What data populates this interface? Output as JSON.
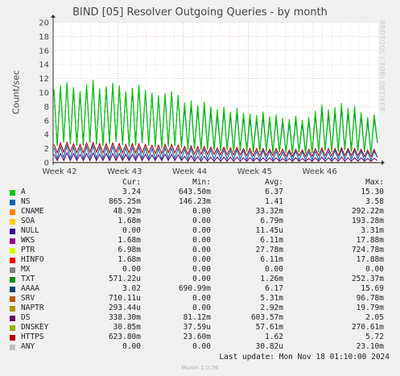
{
  "chart_data": {
    "type": "line",
    "title": "BIND [05] Resolver Outgoing Queries - by month",
    "ylabel": "Count/sec",
    "ylim": [
      0,
      20
    ],
    "yticks": [
      0,
      2,
      4,
      6,
      8,
      10,
      12,
      14,
      16,
      18,
      20
    ],
    "xticks": [
      "Week 42",
      "Week 43",
      "Week 44",
      "Week 45",
      "Week 46"
    ],
    "grid": true,
    "series": [
      {
        "name": "A",
        "color": "#00cc00",
        "cur": "3.24",
        "min": "643.50m",
        "avg": "6.37",
        "max": "15.30",
        "values": [
          10.5,
          2.5,
          11.0,
          3.0,
          11.5,
          2.8,
          10.8,
          2.5,
          10.2,
          2.6,
          11.2,
          3.0,
          11.8,
          2.7,
          10.6,
          2.5,
          10.9,
          2.8,
          11.4,
          3.1,
          11.0,
          2.6,
          10.2,
          2.4,
          10.7,
          2.6,
          11.1,
          2.9,
          10.4,
          2.5,
          10.0,
          2.3,
          9.6,
          2.2,
          9.9,
          2.4,
          10.2,
          2.5,
          9.7,
          2.3,
          8.6,
          2.0,
          8.9,
          2.1,
          8.2,
          1.9,
          8.7,
          2.0,
          8.0,
          1.9,
          7.6,
          1.8,
          8.0,
          1.9,
          7.3,
          1.7,
          7.8,
          1.8,
          7.1,
          1.7,
          7.0,
          1.6,
          6.8,
          1.6,
          7.3,
          1.7,
          6.6,
          1.5,
          6.9,
          1.6,
          6.4,
          1.5,
          6.2,
          1.4,
          6.7,
          1.6,
          6.1,
          1.4,
          6.5,
          1.5,
          7.4,
          1.6,
          8.3,
          1.8,
          7.6,
          1.6,
          7.9,
          1.7,
          8.5,
          1.9,
          7.8,
          1.7,
          8.1,
          1.7,
          7.2,
          1.6,
          6.5,
          1.4,
          6.9,
          3.0
        ]
      },
      {
        "name": "NS",
        "color": "#0066b3",
        "cur": "865.25m",
        "min": "146.23m",
        "avg": "1.41",
        "max": "3.58",
        "values": [
          2.1,
          0.6,
          2.3,
          0.7,
          2.4,
          0.6,
          2.2,
          0.6,
          2.1,
          0.6,
          2.3,
          0.7,
          2.4,
          0.6,
          2.2,
          0.6,
          2.2,
          0.6,
          2.3,
          0.7,
          2.2,
          0.6,
          2.1,
          0.6,
          2.2,
          0.6,
          2.2,
          0.6,
          2.1,
          0.6,
          2.0,
          0.5,
          2.0,
          0.5,
          2.1,
          0.6,
          2.1,
          0.6,
          2.0,
          0.5,
          1.9,
          0.5,
          2.0,
          0.5,
          1.8,
          0.5,
          1.9,
          0.5,
          1.8,
          0.5,
          1.7,
          0.5,
          1.8,
          0.5,
          1.7,
          0.5,
          1.8,
          0.5,
          1.7,
          0.4,
          1.6,
          0.4,
          1.6,
          0.4,
          1.7,
          0.5,
          1.6,
          0.4,
          1.6,
          0.4,
          1.5,
          0.4,
          1.5,
          0.4,
          1.6,
          0.4,
          1.5,
          0.4,
          1.5,
          0.4,
          1.6,
          0.4,
          1.7,
          0.5,
          1.6,
          0.4,
          1.7,
          0.5,
          1.8,
          0.5,
          1.7,
          0.5,
          1.7,
          0.5,
          1.6,
          0.4,
          1.5,
          0.4,
          1.6,
          0.8
        ]
      },
      {
        "name": "CNAME",
        "color": "#ff8000",
        "cur": "48.92m",
        "min": "0.00",
        "avg": "33.32m",
        "max": "292.22m",
        "values": []
      },
      {
        "name": "SOA",
        "color": "#ffcc00",
        "cur": "1.68m",
        "min": "0.00",
        "avg": "6.79m",
        "max": "193.28m",
        "values": []
      },
      {
        "name": "NULL",
        "color": "#330099",
        "cur": "0.00",
        "min": "0.00",
        "avg": "11.45u",
        "max": "3.31m",
        "values": []
      },
      {
        "name": "WKS",
        "color": "#990099",
        "cur": "1.68m",
        "min": "0.00",
        "avg": "6.11m",
        "max": "17.88m",
        "values": []
      },
      {
        "name": "PTR",
        "color": "#ccff00",
        "cur": "6.98m",
        "min": "0.00",
        "avg": "27.78m",
        "max": "724.78m",
        "values": []
      },
      {
        "name": "HINFO",
        "color": "#ff0000",
        "cur": "1.68m",
        "min": "0.00",
        "avg": "6.11m",
        "max": "17.88m",
        "values": []
      },
      {
        "name": "MX",
        "color": "#808080",
        "cur": "0.00",
        "min": "0.00",
        "avg": "0.00",
        "max": "0.00",
        "values": []
      },
      {
        "name": "TXT",
        "color": "#008f00",
        "cur": "571.22u",
        "min": "0.00",
        "avg": "1.26m",
        "max": "252.37m",
        "values": []
      },
      {
        "name": "AAAA",
        "color": "#00487d",
        "cur": "3.02",
        "min": "690.99m",
        "avg": "6.17",
        "max": "15.69",
        "values": [
          10.3,
          2.4,
          10.8,
          2.9,
          11.3,
          2.7,
          10.6,
          2.4,
          10.0,
          2.5,
          11.0,
          2.9,
          11.5,
          2.6,
          10.4,
          2.4,
          10.7,
          2.7,
          11.2,
          3.0,
          10.8,
          2.5,
          10.0,
          2.3,
          10.5,
          2.5,
          10.9,
          2.8,
          10.2,
          2.4,
          9.8,
          2.2,
          9.4,
          2.1,
          9.7,
          2.3,
          10.0,
          2.4,
          9.5,
          2.2,
          8.0,
          1.9,
          8.3,
          2.0,
          7.7,
          1.8,
          8.1,
          1.9,
          7.4,
          1.8,
          7.0,
          1.7,
          7.4,
          1.8,
          6.8,
          1.6,
          7.2,
          1.7,
          6.6,
          1.6,
          6.4,
          1.5,
          6.3,
          1.5,
          6.7,
          1.6,
          6.1,
          1.4,
          6.4,
          1.5,
          5.9,
          1.4,
          5.7,
          1.3,
          6.2,
          1.5,
          5.6,
          1.3,
          6.0,
          1.4,
          6.9,
          1.5,
          7.7,
          1.7,
          7.0,
          1.5,
          7.3,
          1.6,
          7.9,
          1.8,
          7.2,
          1.6,
          7.5,
          1.6,
          6.7,
          1.5,
          6.0,
          1.3,
          6.4,
          2.8
        ]
      },
      {
        "name": "SRV",
        "color": "#b35a00",
        "cur": "710.11u",
        "min": "0.00",
        "avg": "5.31m",
        "max": "96.78m",
        "values": []
      },
      {
        "name": "NAPTR",
        "color": "#b38f00",
        "cur": "293.44u",
        "min": "0.00",
        "avg": "2.92m",
        "max": "19.79m",
        "values": []
      },
      {
        "name": "DS",
        "color": "#6b006b",
        "cur": "338.30m",
        "min": "81.12m",
        "avg": "603.57m",
        "max": "2.05",
        "values": [
          1.2,
          0.3,
          1.3,
          0.3,
          1.4,
          0.3,
          1.3,
          0.3,
          1.2,
          0.3,
          1.3,
          0.3,
          1.4,
          0.3,
          1.2,
          0.3,
          1.3,
          0.3,
          1.3,
          0.3,
          1.3,
          0.3,
          1.2,
          0.3,
          1.2,
          0.3,
          1.3,
          0.3,
          1.2,
          0.3,
          1.1,
          0.3,
          1.1,
          0.3,
          1.2,
          0.3,
          1.2,
          0.3,
          1.1,
          0.3,
          0.9,
          0.2,
          1.0,
          0.2,
          0.9,
          0.2,
          0.9,
          0.2,
          0.8,
          0.2,
          0.8,
          0.2,
          0.8,
          0.2,
          0.8,
          0.2,
          0.8,
          0.2,
          0.7,
          0.2,
          0.7,
          0.2,
          0.7,
          0.2,
          0.7,
          0.2,
          0.7,
          0.2,
          0.7,
          0.2,
          0.6,
          0.2,
          0.6,
          0.2,
          0.7,
          0.2,
          0.6,
          0.2,
          0.6,
          0.2,
          0.7,
          0.2,
          0.8,
          0.2,
          0.7,
          0.2,
          0.7,
          0.2,
          0.8,
          0.2,
          0.7,
          0.2,
          0.7,
          0.2,
          0.7,
          0.2,
          0.6,
          0.2,
          0.6,
          0.3
        ]
      },
      {
        "name": "DNSKEY",
        "color": "#8fb300",
        "cur": "30.85m",
        "min": "37.59u",
        "avg": "57.61m",
        "max": "270.61m",
        "values": []
      },
      {
        "name": "HTTPS",
        "color": "#b30000",
        "cur": "623.80m",
        "min": "23.60m",
        "avg": "1.62",
        "max": "5.72",
        "values": [
          2.6,
          1.4,
          2.8,
          1.5,
          2.9,
          1.5,
          2.7,
          1.4,
          2.6,
          1.4,
          2.8,
          1.5,
          2.9,
          1.5,
          2.7,
          1.4,
          2.7,
          1.4,
          2.8,
          1.5,
          2.7,
          1.4,
          2.6,
          1.4,
          2.7,
          1.4,
          2.7,
          1.4,
          2.6,
          1.4,
          2.5,
          1.3,
          2.5,
          1.3,
          2.6,
          1.4,
          2.6,
          1.4,
          2.5,
          1.3,
          2.3,
          1.2,
          2.4,
          1.2,
          2.3,
          1.2,
          2.3,
          1.2,
          2.2,
          1.2,
          2.1,
          1.1,
          2.2,
          1.1,
          2.1,
          1.1,
          2.2,
          1.1,
          2.0,
          1.0,
          2.0,
          1.0,
          2.0,
          1.0,
          2.0,
          1.0,
          1.9,
          1.0,
          2.0,
          1.0,
          1.9,
          0.9,
          1.8,
          0.9,
          1.9,
          1.0,
          1.8,
          0.9,
          1.9,
          0.9,
          2.0,
          1.0,
          2.1,
          1.0,
          2.0,
          1.0,
          2.0,
          1.0,
          2.1,
          1.0,
          2.0,
          1.0,
          2.0,
          1.0,
          1.9,
          0.9,
          1.8,
          0.9,
          1.9,
          0.7
        ]
      },
      {
        "name": "ANY",
        "color": "#bebebe",
        "cur": "0.00",
        "min": "0.00",
        "avg": "30.82u",
        "max": "23.10m",
        "values": []
      }
    ]
  },
  "page": {
    "ylabel": "Count/sec",
    "side_text": "RRDTOOL / TOBI OETIKER",
    "legend_headers": {
      "cur": "Cur:",
      "min": "Min:",
      "avg": "Avg:",
      "max": "Max:"
    },
    "last_update": "Last update: Mon Nov 18 01:10:00 2024",
    "version": "Munin 2.0.76"
  }
}
